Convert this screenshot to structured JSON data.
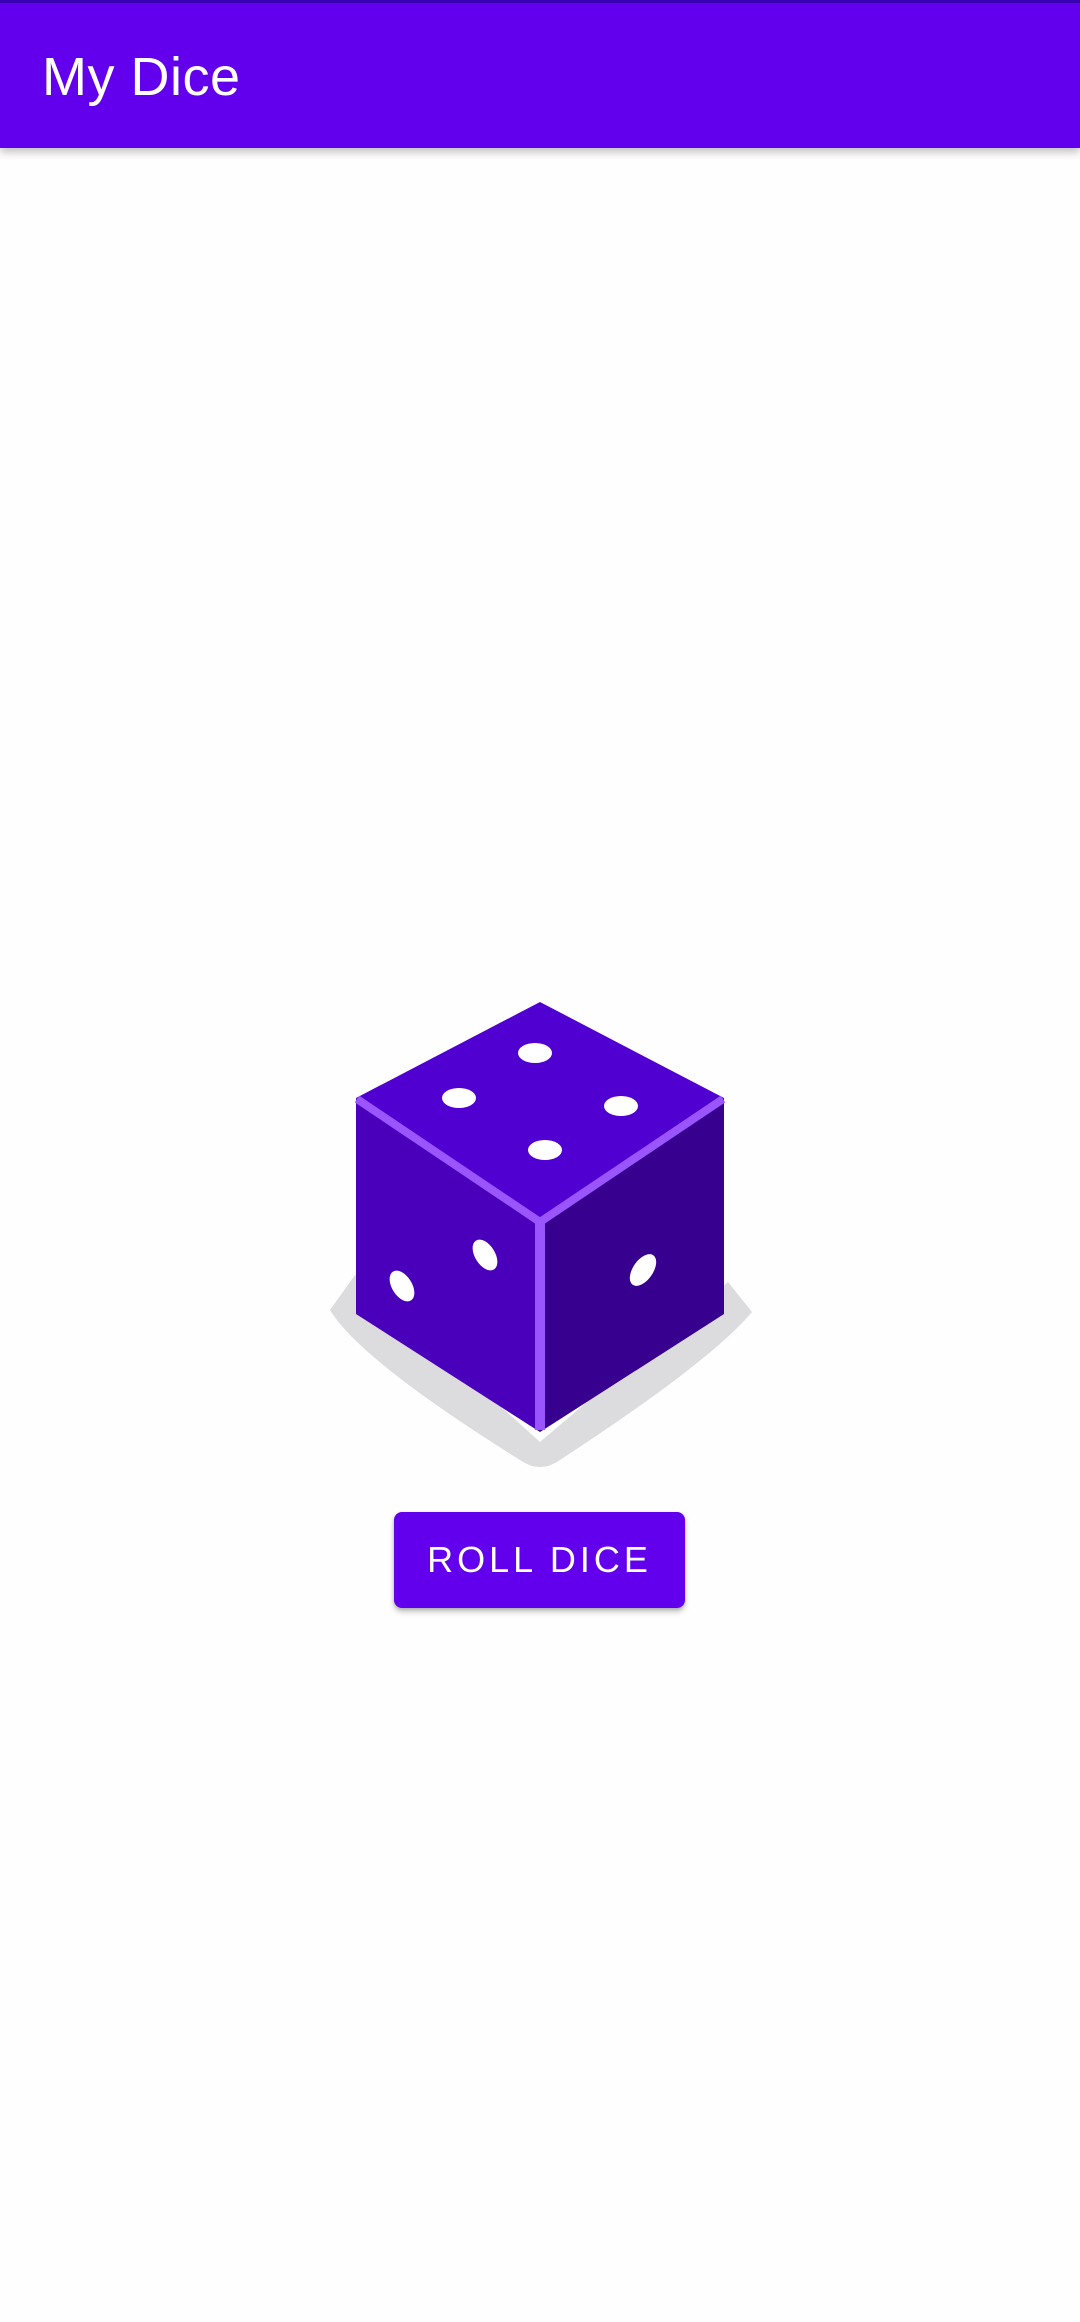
{
  "app_bar": {
    "title": "My Dice",
    "color": "#6200ee",
    "status_color": "#3700b3"
  },
  "dice": {
    "icon": "dice-icon",
    "top_face_value": 4,
    "left_face_value": 2,
    "right_face_value": 1,
    "colors": {
      "top": "#5000d0",
      "left": "#4a00bb",
      "right": "#38008f",
      "edge": "#9a55ff",
      "pip": "#ffffff",
      "shadow": "#dcdbdd"
    }
  },
  "roll_button": {
    "label": "ROLL DICE",
    "color": "#6200ee"
  }
}
